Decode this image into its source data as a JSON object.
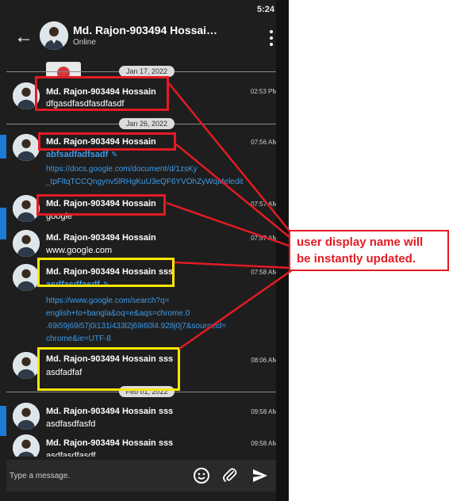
{
  "status_bar": {
    "time": "5:24"
  },
  "header": {
    "title": "Md. Rajon-903494 Hossai…",
    "subtitle": "Online"
  },
  "dates": [
    "Jan 17, 2022",
    "Jan 26, 2022",
    "Feb 01, 2022"
  ],
  "messages": [
    {
      "sender": "Md. Rajon-903494 Hossain",
      "time": "02:53 PM",
      "body": "dfgasdfasdfasdfasdf"
    },
    {
      "sender": "Md. Rajon-903494 Hossain",
      "time": "07:56 AM",
      "body": "abfsadfadfsadf",
      "link_lines": [
        "https://docs.google.com/document/d/1zsKy",
        "_tpFltqTCCQngynv5lRHgKuU3eQF6YVOhZyWqMeledit"
      ]
    },
    {
      "sender": "Md. Rajon-903494 Hossain",
      "time": "07:57 AM",
      "body": "google"
    },
    {
      "sender": "Md. Rajon-903494 Hossain",
      "time": "07:57 AM",
      "body": "www.google.com"
    },
    {
      "sender": "Md. Rajon-903494 Hossain sss",
      "time": "07:58 AM",
      "body": "asdfasdfasdf",
      "link_lines": [
        "https://www.google.com/search?q=",
        "english+to+bangla&oq=e&aqs=chrome.0",
        ".69i59j69i57j0i131i433l2j69i60l4.928j0j7&sourceid=",
        "chrome&ie=UTF-8"
      ]
    },
    {
      "sender": "Md. Rajon-903494 Hossain sss",
      "time": "08:06 AM",
      "body": "asdfadfaf"
    },
    {
      "sender": "Md. Rajon-903494 Hossain sss",
      "time": "09:58 AM",
      "body": "asdfasdfasfd"
    },
    {
      "sender": "Md. Rajon-903494 Hossain sss",
      "time": "09:58 AM",
      "body": "asdfasdfasdf"
    }
  ],
  "composer": {
    "placeholder": "Type a message."
  },
  "annotation": {
    "line1": "user display name will",
    "line2": "be instantly updated."
  },
  "colors": {
    "background": "#1e1e1e",
    "link": "#3d9be9",
    "annotation_red": "#e31b23",
    "annotation_yellow": "#ffe600"
  },
  "icons": [
    "back-arrow-icon",
    "more-vert-icon",
    "pencil-icon",
    "emoji-icon",
    "attach-icon",
    "send-icon"
  ]
}
